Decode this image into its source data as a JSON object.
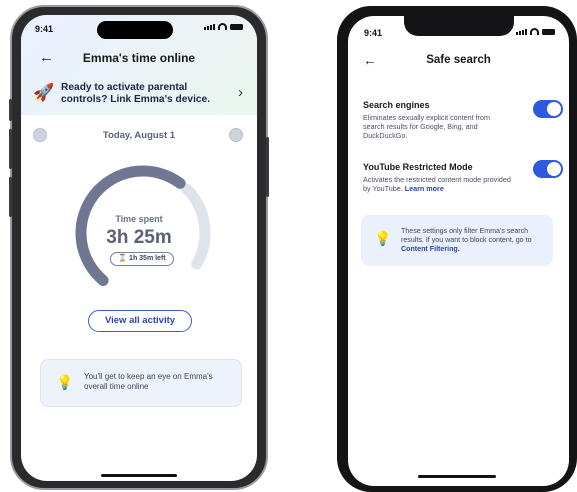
{
  "phone1": {
    "status_time": "9:41",
    "title": "Emma's time online",
    "promo_text": "Ready to activate parental controls? Link Emma's device.",
    "date": "Today, August 1",
    "time_spent_label": "Time spent",
    "time_spent_value": "3h 25m",
    "time_left": "1h 35m left",
    "time_used_fraction": 0.68,
    "view_all_label": "View all activity",
    "tip_text": "You'll get to keep an eye on Emma's overall time online"
  },
  "phone2": {
    "status_time": "9:41",
    "title": "Safe search",
    "settings": [
      {
        "title": "Search engines",
        "description": "Eliminates sexually explicit content from search results for Google, Bing, and DuckDuckGo.",
        "enabled": true
      },
      {
        "title": "YouTube Restricted Mode",
        "description": "Activates the restricted content mode provided by YouTube.",
        "link": "Learn more",
        "enabled": true
      }
    ],
    "tip_text": "These settings only filter Emma's search results. If you want to block content, go to",
    "tip_link": "Content Filtering."
  },
  "colors": {
    "accent": "#2f5ae0",
    "gauge_used": "#707792",
    "gauge_rest": "#dfe3ec"
  }
}
